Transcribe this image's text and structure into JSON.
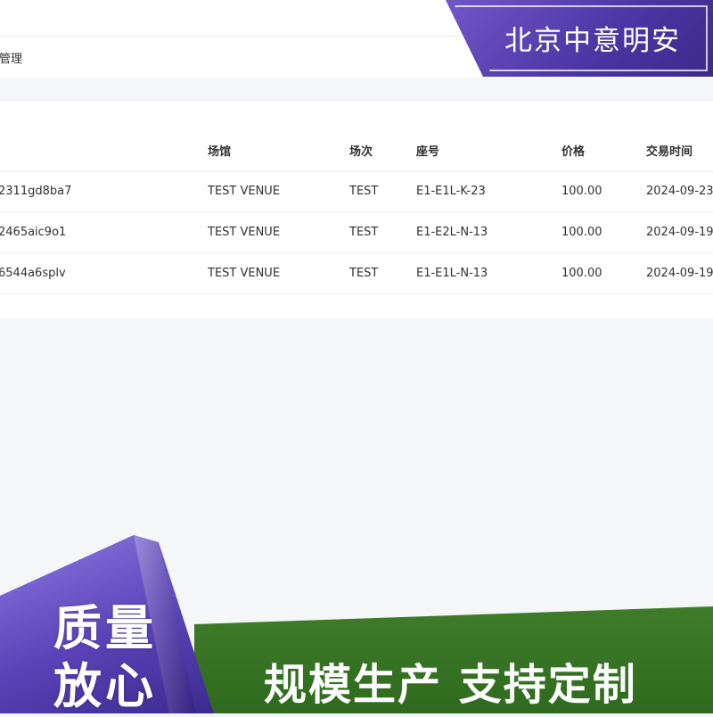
{
  "breadcrumb": "票管理",
  "table": {
    "headers": [
      "",
      "场馆",
      "场次",
      "座号",
      "价格",
      "交易时间"
    ],
    "rows": [
      [
        "2311gd8ba7",
        "TEST VENUE",
        "TEST",
        "E1-E1L-K-23",
        "100.00",
        "2024-09-23"
      ],
      [
        "2465aic9o1",
        "TEST VENUE",
        "TEST",
        "E1-E2L-N-13",
        "100.00",
        "2024-09-19"
      ],
      [
        "6544a6splv",
        "TEST VENUE",
        "TEST",
        "E1-E1L-N-13",
        "100.00",
        "2024-09-19"
      ]
    ]
  },
  "overlay": {
    "brand": "北京中意明安",
    "quality_line1": "质量",
    "quality_line2": "放心",
    "slogan": "规模生产  支持定制"
  },
  "colors": {
    "brand_purple": "#4a35a3",
    "green": "#2f6a1e"
  }
}
